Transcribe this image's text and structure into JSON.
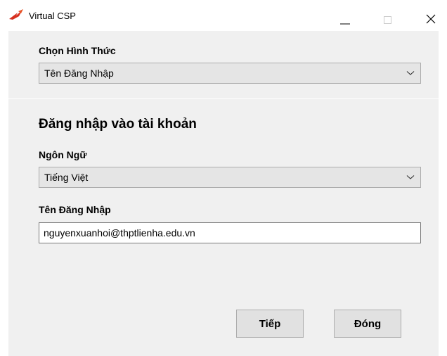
{
  "window": {
    "title": "Virtual CSP",
    "icons": {
      "app": "red-dart-logo-icon",
      "minimize": "minimize-icon",
      "maximize": "maximize-icon",
      "close": "close-icon"
    },
    "accent_color": "#d7301f"
  },
  "method": {
    "label": "Chọn Hình Thức",
    "selected": "Tên Đăng Nhập"
  },
  "login": {
    "heading": "Đăng nhập vào tài khoản",
    "language_label": "Ngôn Ngữ",
    "language_selected": "Tiếng Việt",
    "username_label": "Tên Đăng Nhập",
    "username_value": "nguyenxuanhoi@thptlienha.edu.vn"
  },
  "buttons": {
    "next": "Tiếp",
    "close": "Đóng"
  }
}
